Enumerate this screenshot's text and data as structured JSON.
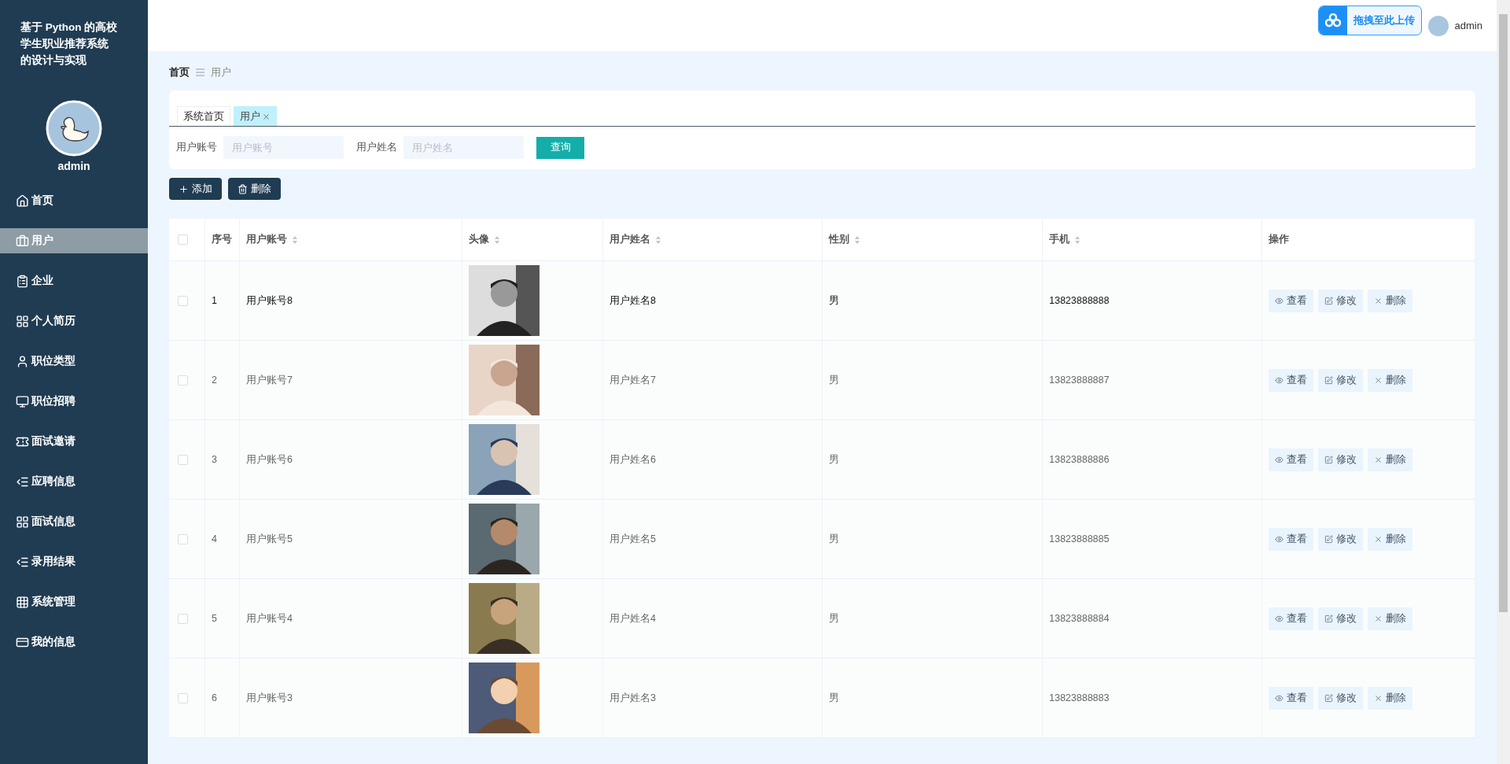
{
  "sidebar": {
    "title": "基于 Python 的高校学生职业推荐系统的设计与实现",
    "user": "admin",
    "items": [
      {
        "label": "首页",
        "selected": false
      },
      {
        "label": "用户",
        "selected": true
      },
      {
        "label": "企业",
        "selected": false
      },
      {
        "label": "个人简历",
        "selected": false
      },
      {
        "label": "职位类型",
        "selected": false
      },
      {
        "label": "职位招聘",
        "selected": false
      },
      {
        "label": "面试邀请",
        "selected": false
      },
      {
        "label": "应聘信息",
        "selected": false
      },
      {
        "label": "面试信息",
        "selected": false
      },
      {
        "label": "录用结果",
        "selected": false
      },
      {
        "label": "系统管理",
        "selected": false
      },
      {
        "label": "我的信息",
        "selected": false
      }
    ]
  },
  "topbar": {
    "upload_button": "拖拽至此上传",
    "user": "admin"
  },
  "breadcrumb": [
    "首页",
    "用户"
  ],
  "tabs": [
    {
      "label": "系统首页",
      "selected": false,
      "closable": false
    },
    {
      "label": "用户",
      "selected": true,
      "closable": true
    }
  ],
  "search": {
    "fields": [
      {
        "label": "用户账号",
        "placeholder": "用户账号"
      },
      {
        "label": "用户姓名",
        "placeholder": "用户姓名"
      }
    ],
    "button": "查询"
  },
  "actions": [
    {
      "label": "添加",
      "kind": "add"
    },
    {
      "label": "删除",
      "kind": "delete"
    }
  ],
  "table": {
    "select_all_checked": false,
    "columns": [
      {
        "label": "序号",
        "sortable": false
      },
      {
        "label": "用户账号",
        "sortable": true
      },
      {
        "label": "头像",
        "sortable": true
      },
      {
        "label": "用户姓名",
        "sortable": true
      },
      {
        "label": "性别",
        "sortable": true
      },
      {
        "label": "手机",
        "sortable": true
      },
      {
        "label": "操作",
        "sortable": false
      }
    ],
    "rows": [
      {
        "checked": false,
        "highlighted": true,
        "index": "1",
        "account": "用户账号8",
        "name": "用户姓名8",
        "gender": "男",
        "phone": "13823888888",
        "actions": [
          {
            "label": "查看",
            "kind": "view"
          },
          {
            "label": "修改",
            "kind": "edit"
          },
          {
            "label": "删除",
            "kind": "delete"
          }
        ]
      },
      {
        "checked": false,
        "highlighted": false,
        "index": "2",
        "account": "用户账号7",
        "name": "用户姓名7",
        "gender": "男",
        "phone": "13823888887",
        "actions": [
          {
            "label": "查看",
            "kind": "view"
          },
          {
            "label": "修改",
            "kind": "edit"
          },
          {
            "label": "删除",
            "kind": "delete"
          }
        ]
      },
      {
        "checked": false,
        "highlighted": false,
        "index": "3",
        "account": "用户账号6",
        "name": "用户姓名6",
        "gender": "男",
        "phone": "13823888886",
        "actions": [
          {
            "label": "查看",
            "kind": "view"
          },
          {
            "label": "修改",
            "kind": "edit"
          },
          {
            "label": "删除",
            "kind": "delete"
          }
        ]
      },
      {
        "checked": false,
        "highlighted": false,
        "index": "4",
        "account": "用户账号5",
        "name": "用户姓名5",
        "gender": "男",
        "phone": "13823888885",
        "actions": [
          {
            "label": "查看",
            "kind": "view"
          },
          {
            "label": "修改",
            "kind": "edit"
          },
          {
            "label": "删除",
            "kind": "delete"
          }
        ]
      },
      {
        "checked": false,
        "highlighted": false,
        "index": "5",
        "account": "用户账号4",
        "name": "用户姓名4",
        "gender": "男",
        "phone": "13823888884",
        "actions": [
          {
            "label": "查看",
            "kind": "view"
          },
          {
            "label": "修改",
            "kind": "edit"
          },
          {
            "label": "删除",
            "kind": "delete"
          }
        ]
      },
      {
        "checked": false,
        "highlighted": false,
        "index": "6",
        "account": "用户账号3",
        "name": "用户姓名3",
        "gender": "男",
        "phone": "13823888883",
        "actions": [
          {
            "label": "查看",
            "kind": "view"
          },
          {
            "label": "修改",
            "kind": "edit"
          },
          {
            "label": "删除",
            "kind": "delete"
          }
        ]
      }
    ]
  }
}
